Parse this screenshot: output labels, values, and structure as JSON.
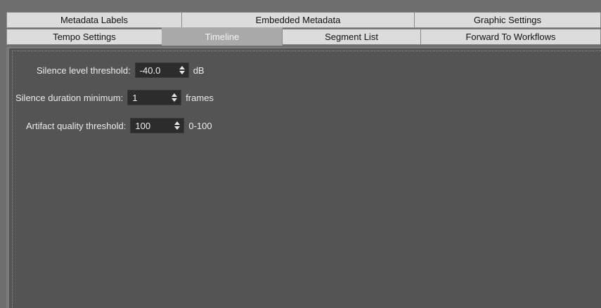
{
  "tabs": {
    "back_row": [
      {
        "label": "Metadata Labels"
      },
      {
        "label": "Embedded Metadata"
      },
      {
        "label": "Graphic Settings"
      }
    ],
    "front_row": [
      {
        "label": "Tempo Settings"
      },
      {
        "label": "Timeline",
        "selected": true
      },
      {
        "label": "Segment List"
      },
      {
        "label": "Forward To Workflows"
      }
    ]
  },
  "fields": [
    {
      "label": "Silence level threshold:",
      "value": "-40.0",
      "unit": "dB"
    },
    {
      "label": "Silence duration minimum:",
      "value": "1",
      "unit": "frames"
    },
    {
      "label": "Artifact quality threshold:",
      "value": "100",
      "unit": "0-100"
    }
  ],
  "icons": {
    "spinner": "up-down-spinner-icon"
  },
  "colors": {
    "tab_background": "#dcdcdc",
    "tab_selected": "#a9a9a9",
    "panel_background": "#545454",
    "input_background": "#2c2c2c"
  }
}
